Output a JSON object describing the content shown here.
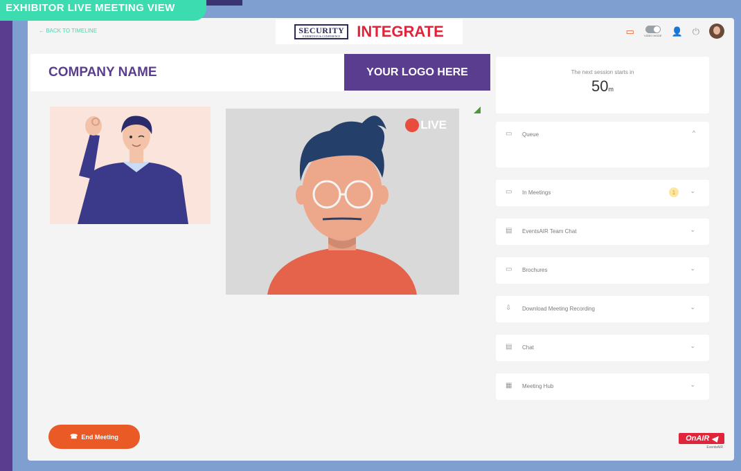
{
  "banner": {
    "title": "EXHIBITOR LIVE MEETING VIEW"
  },
  "topbar": {
    "back_link": "← BACK TO TIMELINE",
    "brand_security": "SECURITY",
    "brand_security_sub": "EXHIBITION & CONFERENCE",
    "brand_integrate": "INTEGRATE",
    "toggle_label": "VIDEO MODE"
  },
  "company": {
    "name": "COMPANY NAME",
    "logo": "YOUR LOGO HERE"
  },
  "video": {
    "live_label": "LIVE"
  },
  "session": {
    "text": "The next session starts in",
    "count": "50",
    "unit": "m"
  },
  "panels": [
    {
      "label": "Queue",
      "icon": "folder-icon",
      "chevron": "^"
    },
    {
      "label": "In Meetings",
      "icon": "folder-icon",
      "chevron": "⌄",
      "badge": "1"
    },
    {
      "label": "EventsAIR Team Chat",
      "icon": "chat-icon",
      "chevron": "⌄"
    },
    {
      "label": "Brochures",
      "icon": "folder-icon",
      "chevron": "⌄"
    },
    {
      "label": "Download Meeting Recording",
      "icon": "download-icon",
      "chevron": "⌄"
    },
    {
      "label": "Chat",
      "icon": "chat-icon",
      "chevron": "⌄"
    },
    {
      "label": "Meeting Hub",
      "icon": "calendar-icon",
      "chevron": "⌄"
    }
  ],
  "end_meeting": {
    "label": "End Meeting"
  },
  "onair": {
    "label": "OnAIR",
    "sub": "EventsAIR"
  },
  "colors": {
    "purple": "#5a3d8e",
    "teal": "#3ddcb0",
    "orange": "#ea5a26",
    "red": "#e0243a"
  }
}
